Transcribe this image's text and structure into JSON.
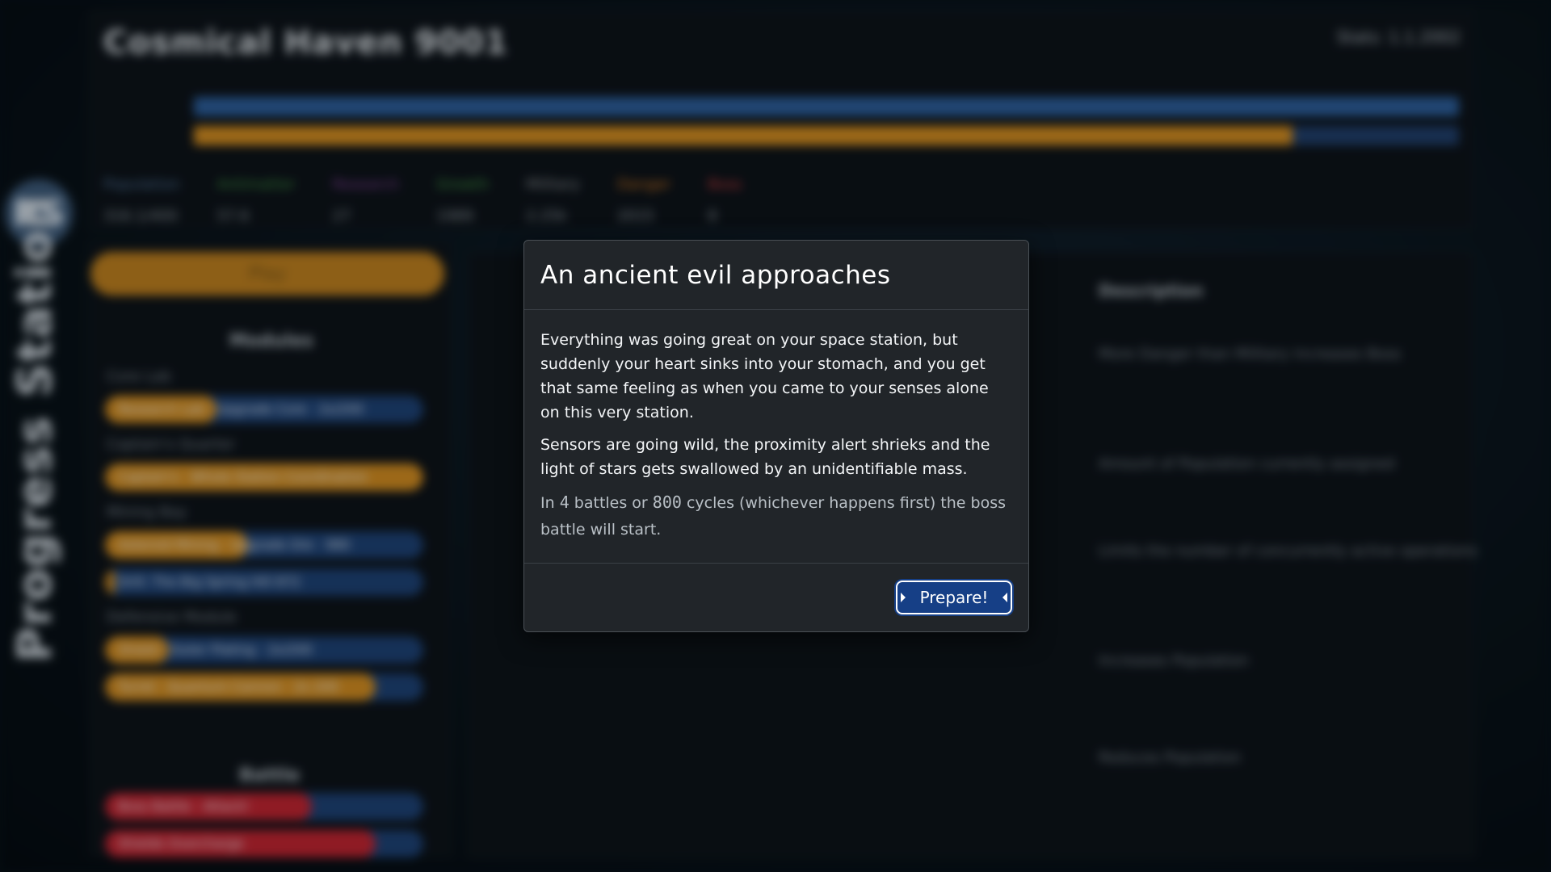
{
  "background": {
    "brand_badge": "PS",
    "brand_vertical": "Progress Station",
    "game_title": "Cosmical Haven 9001",
    "stats_text": "Stats: 1.1.2002",
    "resources": [
      {
        "label": "Population",
        "value": "316.1/400",
        "color": "#4d6f95"
      },
      {
        "label": "Antimatter",
        "value": "57.6",
        "color": "#3d8b3d"
      },
      {
        "label": "Research",
        "value": "27",
        "color": "#7b3d8f"
      },
      {
        "label": "Growth",
        "value": "1989",
        "color": "#3f8f3f"
      },
      {
        "label": "Military",
        "value": "2.25k",
        "color": "#8a8f94"
      },
      {
        "label": "Danger",
        "value": "2015",
        "color": "#c9721f"
      },
      {
        "label": "Boss",
        "value": "8",
        "color": "#c43a3a"
      }
    ],
    "play_label": "Play",
    "modules_title": "Modules",
    "module_groups": [
      {
        "label": "Core Lab",
        "bars": [
          {
            "text": "Research Lab · Upgrade Core · 2x/200",
            "fill": 0.35
          }
        ]
      },
      {
        "label": "Captain's Quarter",
        "bars": [
          {
            "text": "Captain's · Whole Station Coordination",
            "fill": 1.0
          }
        ]
      },
      {
        "label": "Mining Bay",
        "bars": [
          {
            "text": "Asteroid Mining · Upgrade Ore · 980",
            "fill": 0.45
          },
          {
            "text": "Drill: The Big Spring Hill 872",
            "fill": 0.03
          }
        ]
      },
      {
        "label": "Defensive Module",
        "bars": [
          {
            "text": "Shield · Outer Plating · 2x/200",
            "fill": 0.2
          },
          {
            "text": "Turret · Quantum Cannon · 2x 200",
            "fill": 0.85
          }
        ]
      }
    ],
    "battle_title": "Battle",
    "battle_bars": [
      {
        "text": "Boss Battle · Attack!",
        "fill": 0.65
      },
      {
        "text": "Shields Overcharge",
        "fill": 0.85
      }
    ],
    "description_header": "Description",
    "bg_lines": [
      "More Danger than Military increases Boss",
      "Amount of Population currently assigned",
      "Limits the number of concurrently active operations",
      "Increases Population",
      "Reduces Population"
    ]
  },
  "modal": {
    "title": "An ancient evil approaches",
    "paragraph1": "Everything was going great on your space station, but suddenly your heart sinks into your stomach, and you get that same feeling as when you came to your senses alone on this very station.",
    "paragraph2": "Sensors are going wild, the proximity alert shrieks and the light of stars gets swallowed by an unidentifiable mass.",
    "countdown": {
      "prefix": "In",
      "battles": "4",
      "middle": "battles or",
      "cycles": "800",
      "suffix": "cycles (whichever happens first) the boss battle will start."
    },
    "prepare_label": "Prepare!"
  },
  "colors": {
    "modal_bg": "#212529",
    "button_bg": "#163f86",
    "progress_orange": "#c8861f",
    "progress_blue": "#1c3f70",
    "danger_red": "#b8232f"
  }
}
